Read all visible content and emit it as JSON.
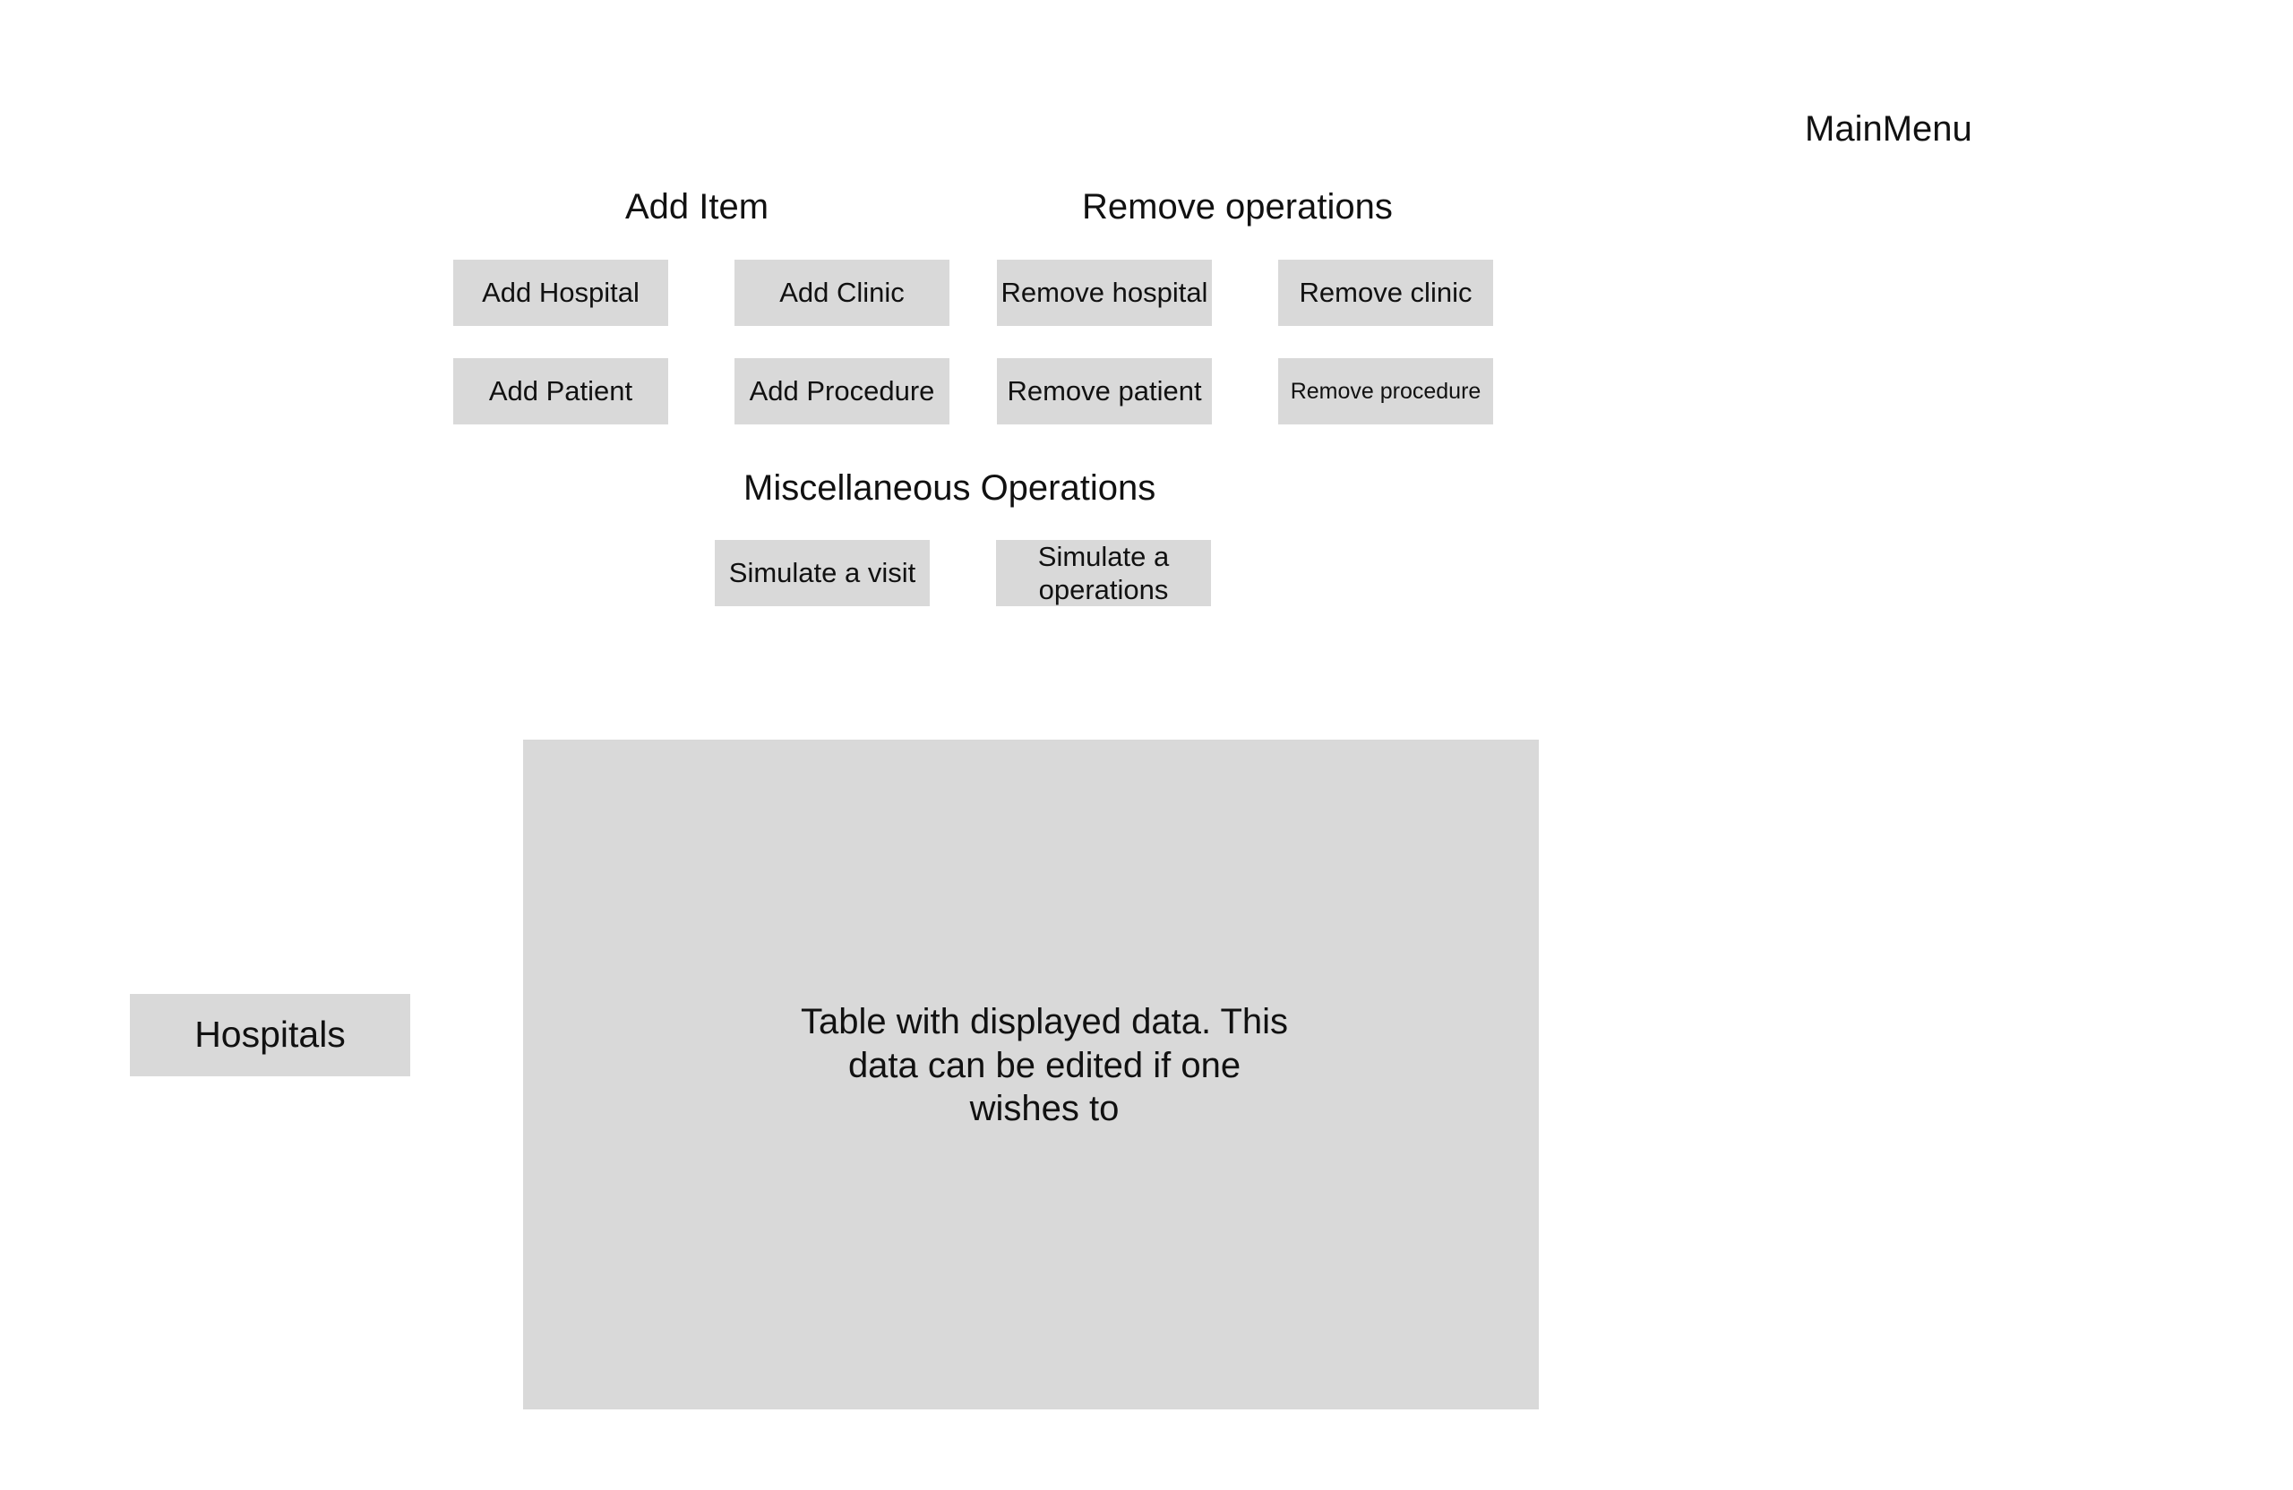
{
  "header": {
    "title": "MainMenu"
  },
  "add_section": {
    "heading": "Add Item",
    "buttons": {
      "hospital": "Add Hospital",
      "clinic": "Add Clinic",
      "patient": "Add Patient",
      "procedure": "Add Procedure"
    }
  },
  "remove_section": {
    "heading": "Remove operations",
    "buttons": {
      "hospital": "Remove hospital",
      "clinic": "Remove clinic",
      "patient": "Remove patient",
      "procedure": "Remove procedure"
    }
  },
  "misc_section": {
    "heading": "Miscellaneous Operations",
    "buttons": {
      "visit": "Simulate a visit",
      "operations": "Simulate a operations"
    }
  },
  "sidebar": {
    "hospitals_label": "Hospitals"
  },
  "table": {
    "placeholder": "Table with displayed data. This data can be edited if one wishes to"
  }
}
